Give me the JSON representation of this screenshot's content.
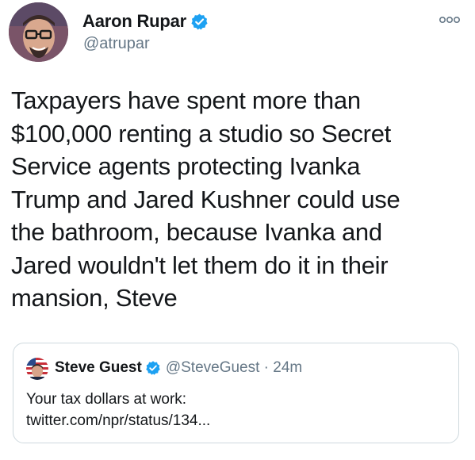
{
  "tweet": {
    "display_name": "Aaron Rupar",
    "handle": "@atrupar",
    "more_label": "ooo",
    "text_lines": [
      "Taxpayers have spent more than",
      "$100,000 renting a studio so Secret",
      "Service agents protecting Ivanka",
      "Trump and Jared Kushner could use",
      "the bathroom, because Ivanka and",
      "Jared wouldn't let them do it in their",
      "mansion, Steve"
    ]
  },
  "quote": {
    "display_name": "Steve Guest",
    "handle_time": "@SteveGuest · 24m",
    "text_lines": [
      "Your tax dollars at work:",
      "twitter.com/npr/status/134..."
    ]
  },
  "colors": {
    "verified": "#1da1f2",
    "secondary_text": "#657786",
    "primary_text": "#14171a",
    "border": "#cfd9de"
  },
  "icons": {
    "verified": "verified-badge-icon",
    "more": "more-options-icon"
  }
}
